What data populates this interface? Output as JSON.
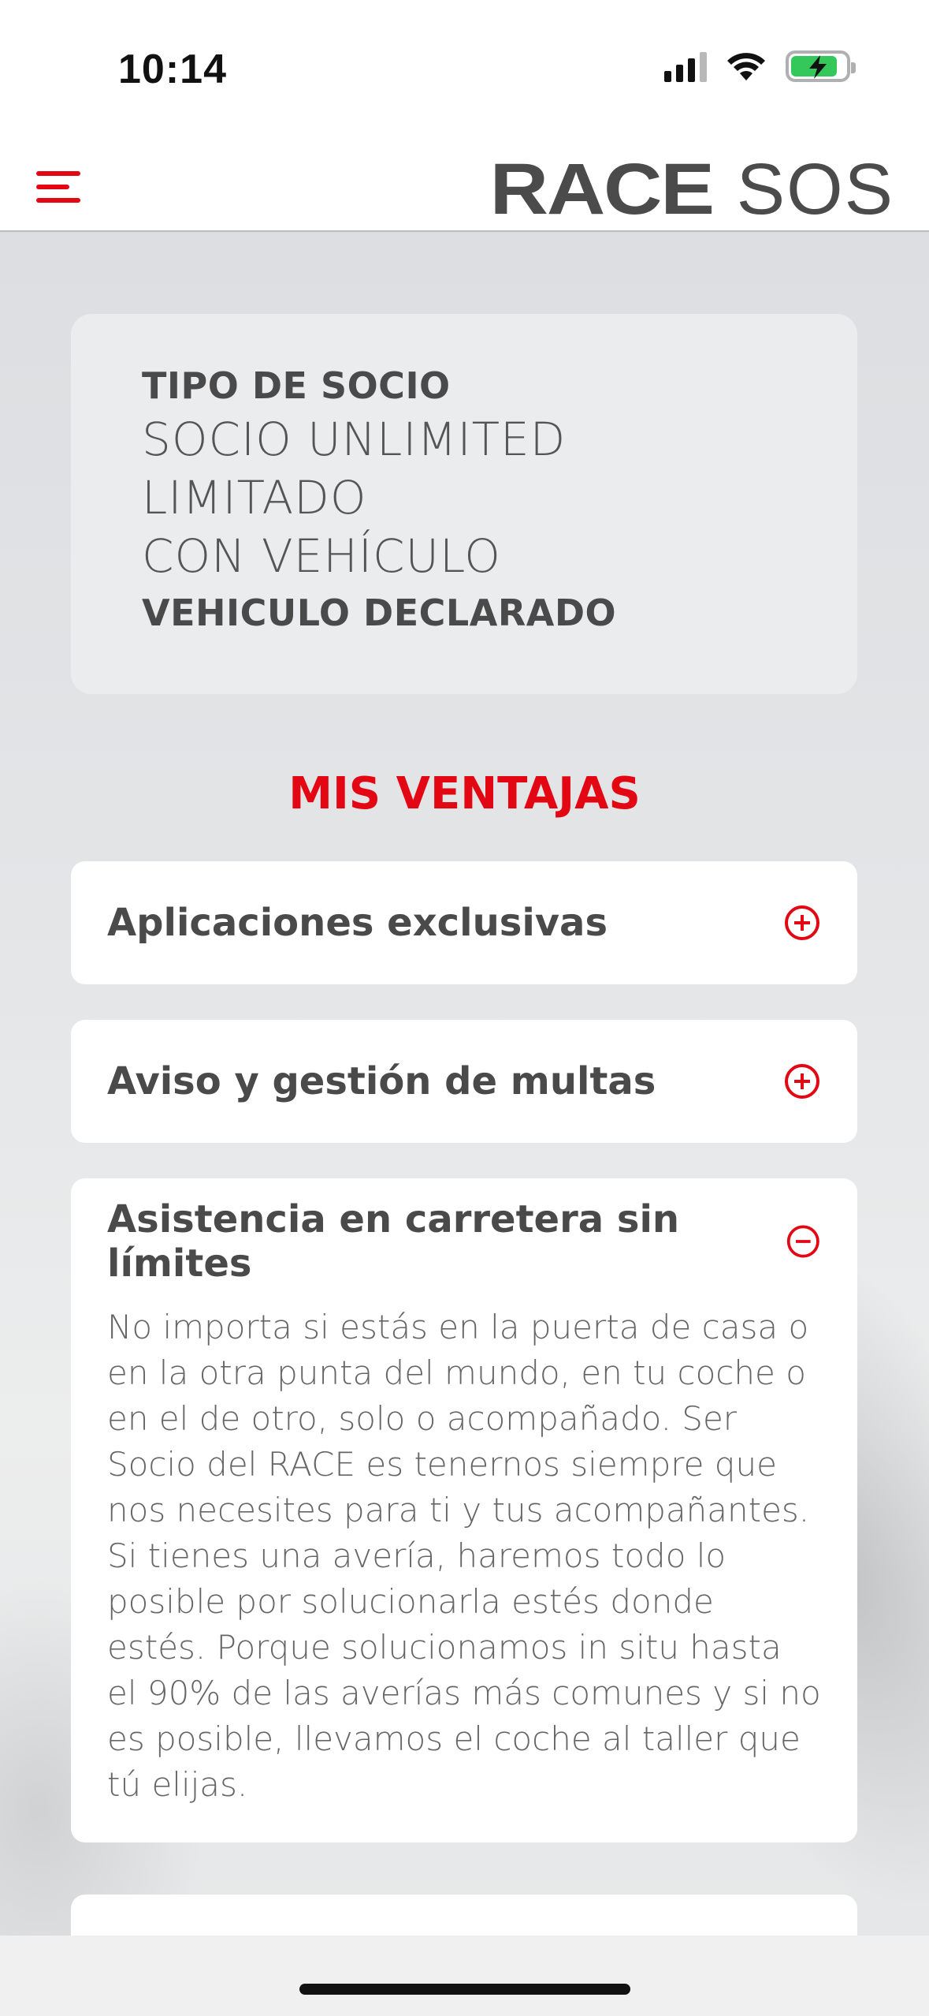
{
  "status_bar": {
    "time": "10:14"
  },
  "header": {
    "logo_primary": "RACE",
    "logo_secondary": "SOS"
  },
  "member_card": {
    "label": "TIPO DE SOCIO",
    "type_line1": "SOCIO UNLIMITED LIMITADO",
    "type_line2": "CON VEHÍCULO",
    "vehicle_status": "VEHICULO DECLARADO"
  },
  "advantages": {
    "title": "MIS VENTAJAS",
    "items": [
      {
        "label": "Aplicaciones exclusivas",
        "expanded": false
      },
      {
        "label": "Aviso y gestión de multas",
        "expanded": false
      },
      {
        "label": "Asistencia en carretera sin límites",
        "expanded": true,
        "description": "No importa si estás en la puerta de casa o en la otra punta del mundo, en tu coche o en el de otro, solo o acompañado. Ser Socio del RACE es tenernos siempre que nos necesites para ti y tus acompañantes. Si tienes una avería, haremos todo lo posible por solucionarla estés donde estés. Porque solucionamos in situ hasta el 90% de las averías más comunes y si no es posible, llevamos el coche al taller que tú elijas."
      }
    ]
  },
  "colors": {
    "accent": "#e30613",
    "text": "#4a4a4a",
    "card_bg": "#ebeced",
    "battery_green": "#34c759"
  }
}
